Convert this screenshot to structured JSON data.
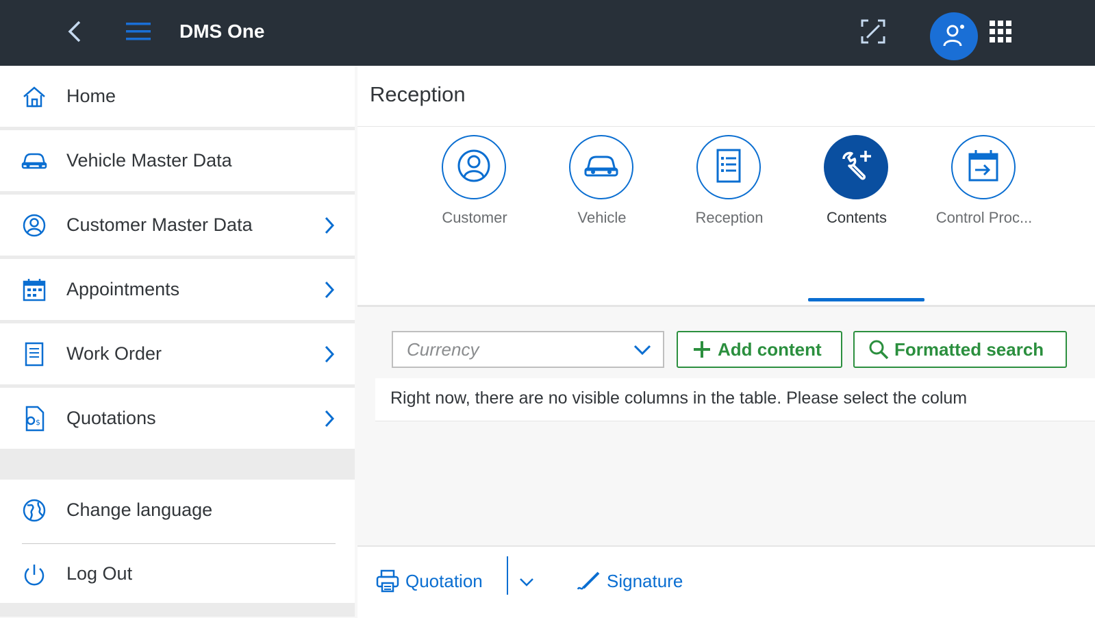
{
  "shell": {
    "title": "DMS One",
    "icons": [
      "back-icon",
      "menu-icon",
      "fullscreen-icon",
      "user-avatar-icon",
      "apps-grid-icon"
    ],
    "colors": {
      "bar": "#283039",
      "avatar": "#1a6fd6"
    }
  },
  "sidebar": {
    "items": [
      {
        "label": "Home",
        "icon": "home-icon",
        "has_submenu": false
      },
      {
        "label": "Vehicle Master Data",
        "icon": "car-icon",
        "has_submenu": false
      },
      {
        "label": "Customer Master Data",
        "icon": "customer-icon",
        "has_submenu": true
      },
      {
        "label": "Appointments",
        "icon": "calendar-icon",
        "has_submenu": true
      },
      {
        "label": "Work Order",
        "icon": "document-icon",
        "has_submenu": true
      },
      {
        "label": "Quotations",
        "icon": "quotation-icon",
        "has_submenu": true
      }
    ],
    "bottom_items": [
      {
        "label": "Change language",
        "icon": "globe-icon"
      },
      {
        "label": "Log Out",
        "icon": "power-icon"
      }
    ]
  },
  "page": {
    "title": "Reception",
    "tabs": [
      {
        "label": "Customer",
        "icon": "customer-icon",
        "active": false
      },
      {
        "label": "Vehicle",
        "icon": "car-icon",
        "active": false
      },
      {
        "label": "Reception",
        "icon": "list-icon",
        "active": false
      },
      {
        "label": "Contents",
        "icon": "wrench-add-icon",
        "active": true
      },
      {
        "label": "Control Proc...",
        "icon": "calendar-arrow-icon",
        "active": false
      }
    ],
    "toolbar": {
      "select_placeholder": "Currency",
      "add_content_label": "Add content",
      "formatted_search_label": "Formatted search"
    },
    "message": "Right now, there are no visible columns in the table. Please select the colum",
    "footer": {
      "quotation_label": "Quotation",
      "signature_label": "Signature"
    }
  },
  "colors": {
    "accent": "#0a6ed1",
    "active_tab": "#0a4fa0",
    "positive": "#2b8f3e"
  }
}
